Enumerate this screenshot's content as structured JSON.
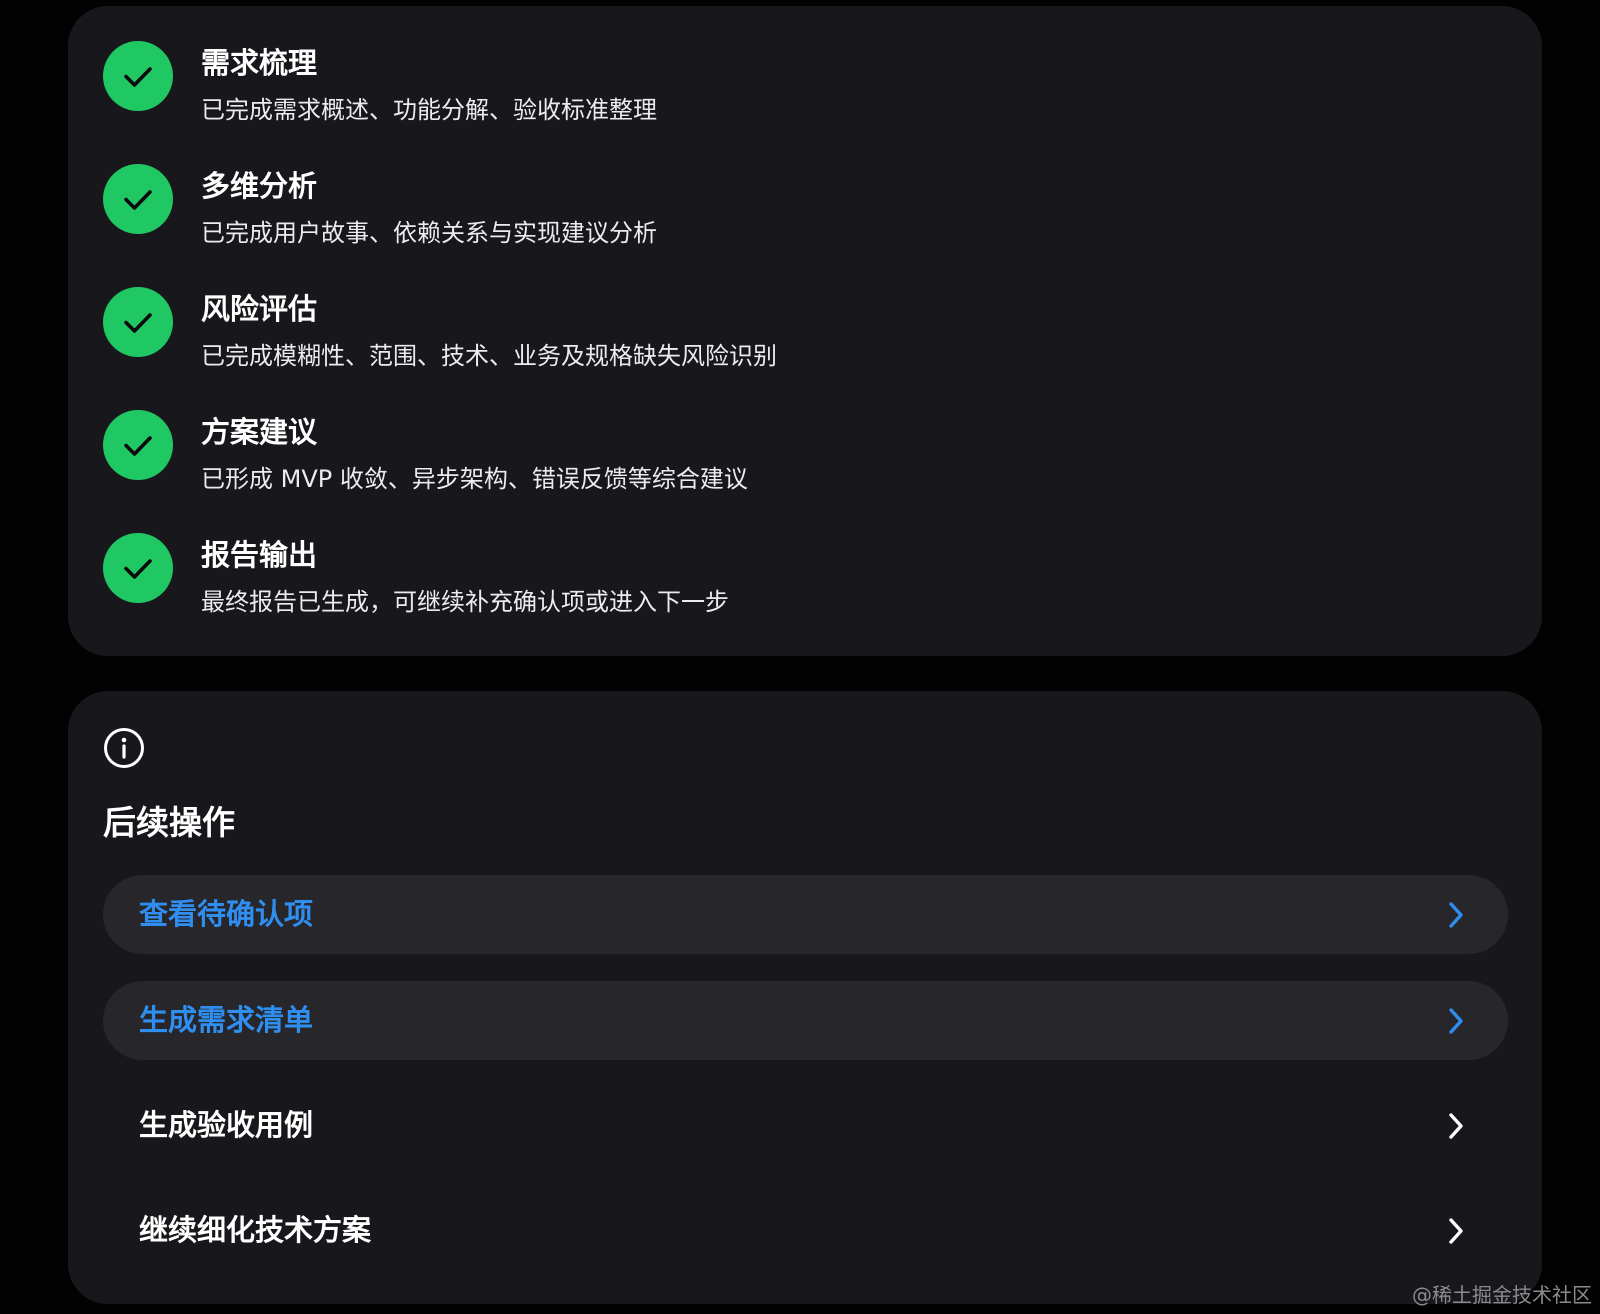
{
  "colors": {
    "background": "#020203",
    "card": "#18181c",
    "success": "#1fc862",
    "accent": "#2f8ef0",
    "row_highlight": "#26262b"
  },
  "steps": [
    {
      "title": "需求梳理",
      "desc": "已完成需求概述、功能分解、验收标准整理",
      "icon": "check-icon"
    },
    {
      "title": "多维分析",
      "desc": "已完成用户故事、依赖关系与实现建议分析",
      "icon": "check-icon"
    },
    {
      "title": "风险评估",
      "desc": "已完成模糊性、范围、技术、业务及规格缺失风险识别",
      "icon": "check-icon"
    },
    {
      "title": "方案建议",
      "desc": "已形成 MVP 收敛、异步架构、错误反馈等综合建议",
      "icon": "check-icon"
    },
    {
      "title": "报告输出",
      "desc": "最终报告已生成，可继续补充确认项或进入下一步",
      "icon": "check-icon"
    }
  ],
  "actions_section": {
    "icon": "info-icon",
    "title": "后续操作",
    "items": [
      {
        "label": "查看待确认项",
        "highlighted": true,
        "icon": "chevron-right-icon"
      },
      {
        "label": "生成需求清单",
        "highlighted": true,
        "icon": "chevron-right-icon"
      },
      {
        "label": "生成验收用例",
        "highlighted": false,
        "icon": "chevron-right-icon"
      },
      {
        "label": "继续细化技术方案",
        "highlighted": false,
        "icon": "chevron-right-icon"
      }
    ]
  },
  "watermark": "@稀土掘金技术社区"
}
